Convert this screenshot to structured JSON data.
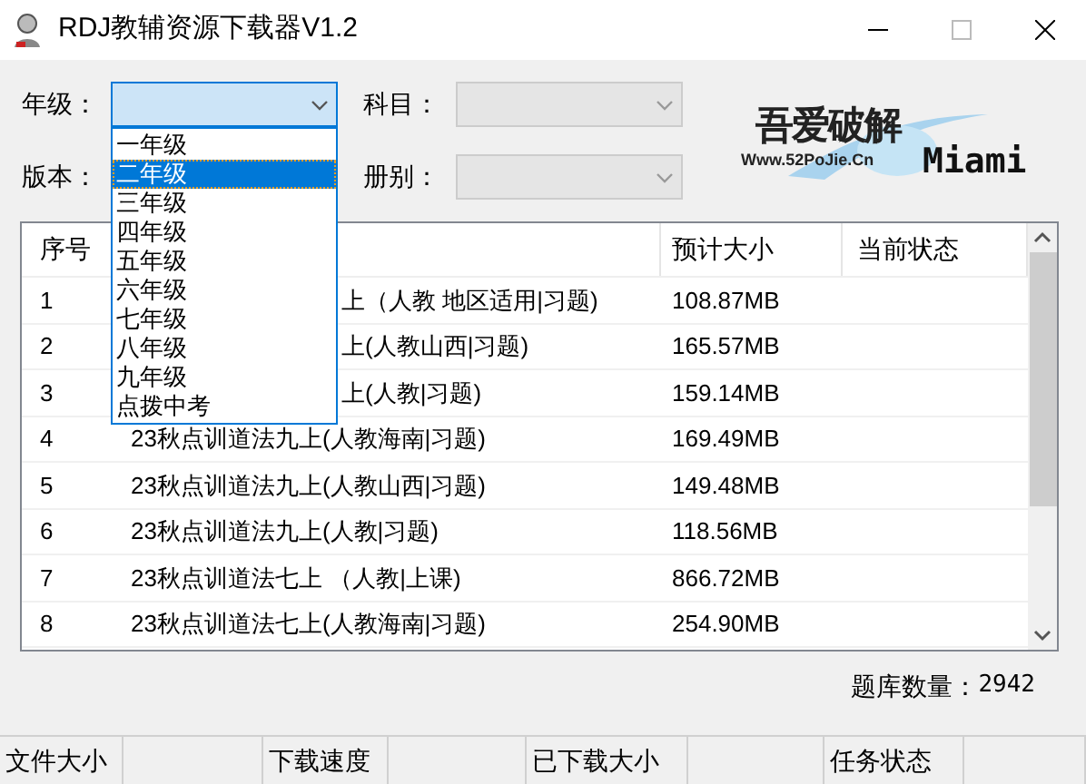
{
  "window": {
    "title": "RDJ教辅资源下载器V1.2"
  },
  "filters": [
    {
      "label": "年级：",
      "focused": true,
      "disabled": false
    },
    {
      "label": "科目：",
      "focused": false,
      "disabled": true
    },
    {
      "label": "版本："
    },
    {
      "label": "册别：",
      "focused": false,
      "disabled": true
    }
  ],
  "grade_dropdown": {
    "expanded": true,
    "options": [
      {
        "label": "一年级",
        "selected": false
      },
      {
        "label": "二年级",
        "selected": true
      },
      {
        "label": "三年级",
        "selected": false
      },
      {
        "label": "四年级",
        "selected": false
      },
      {
        "label": "五年级",
        "selected": false
      },
      {
        "label": "六年级",
        "selected": false
      },
      {
        "label": "七年级",
        "selected": false
      },
      {
        "label": "八年级",
        "selected": false
      },
      {
        "label": "九年级",
        "selected": false
      },
      {
        "label": "点拨中考",
        "selected": false
      }
    ]
  },
  "logo": {
    "main": "吾爱破解",
    "url": "Www.52PoJie.Cn",
    "user": "Miami"
  },
  "table": {
    "columns": [
      "序号",
      "预计大小",
      "当前状态"
    ],
    "rows": [
      {
        "index": "1",
        "title": "上（人教 地区适用|习题)",
        "size": "108.87MB",
        "covered": true
      },
      {
        "index": "2",
        "title": "上(人教山西|习题)",
        "size": "165.57MB",
        "covered": true
      },
      {
        "index": "3",
        "title": "上(人教|习题)",
        "size": "159.14MB",
        "covered": true
      },
      {
        "index": "4",
        "title": "23秋点训道法九上(人教海南|习题)",
        "size": "169.49MB",
        "covered": false
      },
      {
        "index": "5",
        "title": "23秋点训道法九上(人教山西|习题)",
        "size": "149.48MB",
        "covered": false
      },
      {
        "index": "6",
        "title": "23秋点训道法九上(人教|习题)",
        "size": "118.56MB",
        "covered": false
      },
      {
        "index": "7",
        "title": "23秋点训道法七上 （人教|上课)",
        "size": "866.72MB",
        "covered": false
      },
      {
        "index": "8",
        "title": "23秋点训道法七上(人教海南|习题)",
        "size": "254.90MB",
        "covered": false
      }
    ]
  },
  "count": {
    "label": "题库数量：",
    "value": "2942"
  },
  "status_bar": [
    {
      "label": "文件大小"
    },
    {
      "label": "下载速度"
    },
    {
      "label": "已下载大小"
    },
    {
      "label": "任务状态"
    }
  ]
}
